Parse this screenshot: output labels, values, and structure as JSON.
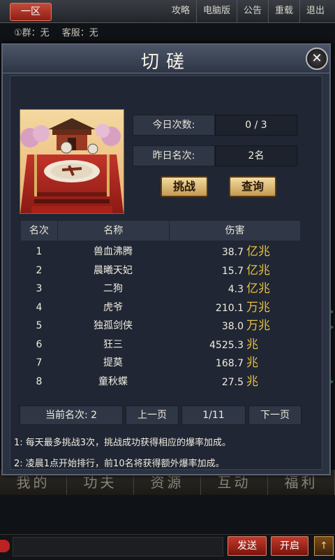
{
  "topbar": {
    "server": "一区",
    "menu": [
      "攻略",
      "电脑版",
      "公告",
      "重载",
      "退出"
    ],
    "group": "①群：无",
    "service": "客服：无"
  },
  "dialog": {
    "title": "切磋",
    "close": "✕",
    "today_label": "今日次数:",
    "today_value": "0 / 3",
    "yesterday_label": "昨日名次:",
    "yesterday_value": "2名",
    "challenge_button": "挑战",
    "query_button": "查询",
    "table": {
      "headers": [
        "名次",
        "名称",
        "伤害"
      ],
      "rows": [
        {
          "rank": "1",
          "name": "兽血沸腾",
          "damage": "38.7",
          "unit": "亿兆"
        },
        {
          "rank": "2",
          "name": "晨曦天妃",
          "damage": "15.7",
          "unit": "亿兆"
        },
        {
          "rank": "3",
          "name": "二狗",
          "damage": "4.3",
          "unit": "亿兆"
        },
        {
          "rank": "4",
          "name": "虎爷",
          "damage": "210.1",
          "unit": "万兆"
        },
        {
          "rank": "5",
          "name": "独孤剑侠",
          "damage": "38.0",
          "unit": "万兆"
        },
        {
          "rank": "6",
          "name": "狂三",
          "damage": "4525.3",
          "unit": "兆"
        },
        {
          "rank": "7",
          "name": "提莫",
          "damage": "168.7",
          "unit": "兆"
        },
        {
          "rank": "8",
          "name": "童秋蝶",
          "damage": "27.5",
          "unit": "兆"
        }
      ]
    },
    "pager": {
      "current_rank": "当前名次: 2",
      "prev": "上一页",
      "page": "1/11",
      "next": "下一页"
    },
    "rules": [
      "1:  每天最多挑战3次，挑战成功获得相应的爆率加成。",
      "2:  凌晨1点开始排行，前10名将获得额外爆率加成。"
    ]
  },
  "bottomnav": [
    "我的",
    "功夫",
    "资源",
    "互动",
    "福利"
  ],
  "chat": {
    "send": "发送",
    "start": "开启",
    "up": "↑"
  }
}
